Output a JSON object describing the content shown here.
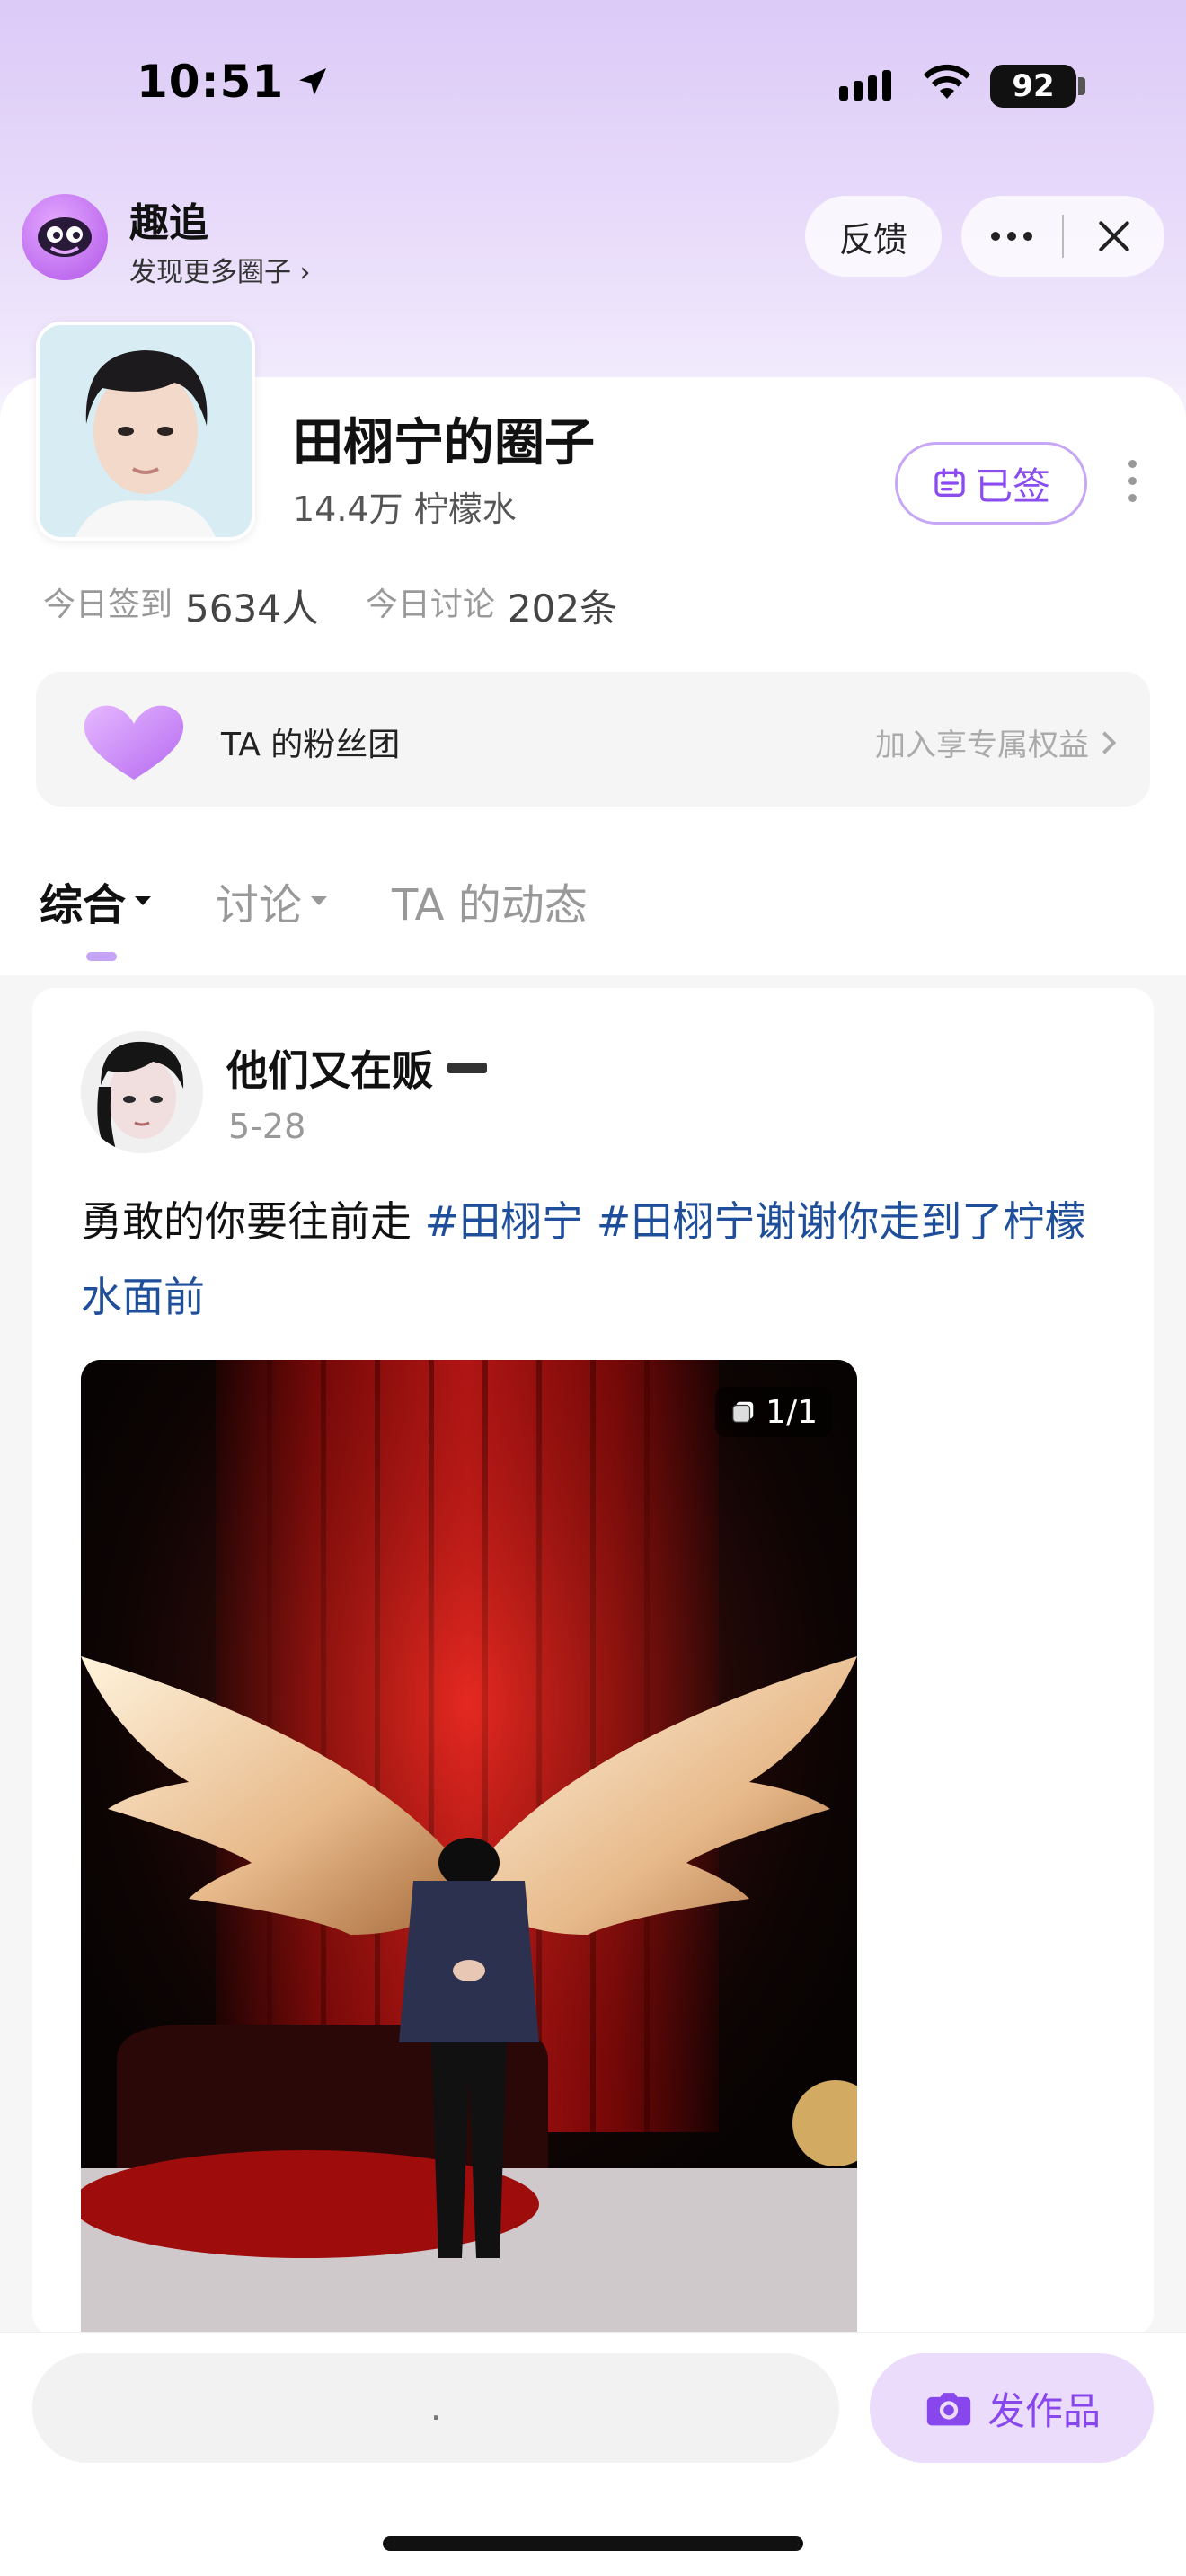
{
  "status_bar": {
    "time": "10:51",
    "battery": "92"
  },
  "app": {
    "name": "趣追",
    "subtitle": "发现更多圈子 ›",
    "feedback_label": "反馈"
  },
  "circle": {
    "title": "田栩宁的圈子",
    "members": "14.4万 柠檬水",
    "signed_label": "已签",
    "stats": {
      "checkin_label": "今日签到",
      "checkin_value": "5634人",
      "discuss_label": "今日讨论",
      "discuss_value": "202条"
    }
  },
  "fan_club": {
    "label": "TA 的粉丝团",
    "cta": "加入享专属权益"
  },
  "tabs": [
    {
      "label": "综合"
    },
    {
      "label": "讨论"
    },
    {
      "label": "TA 的动态"
    }
  ],
  "post": {
    "username": "他们又在贩",
    "date": "5-28",
    "text_plain": "勇敢的你要往前走 ",
    "tags": [
      "#田栩宁",
      "#田栩宁谢谢你走到了柠檬水面前"
    ],
    "image_count": "1/1"
  },
  "bottom": {
    "input_text": ".",
    "post_button": "发作品"
  },
  "colors": {
    "accent": "#8a4cf0",
    "tag": "#1f4f9a",
    "header_bg": "#dccaf7"
  }
}
